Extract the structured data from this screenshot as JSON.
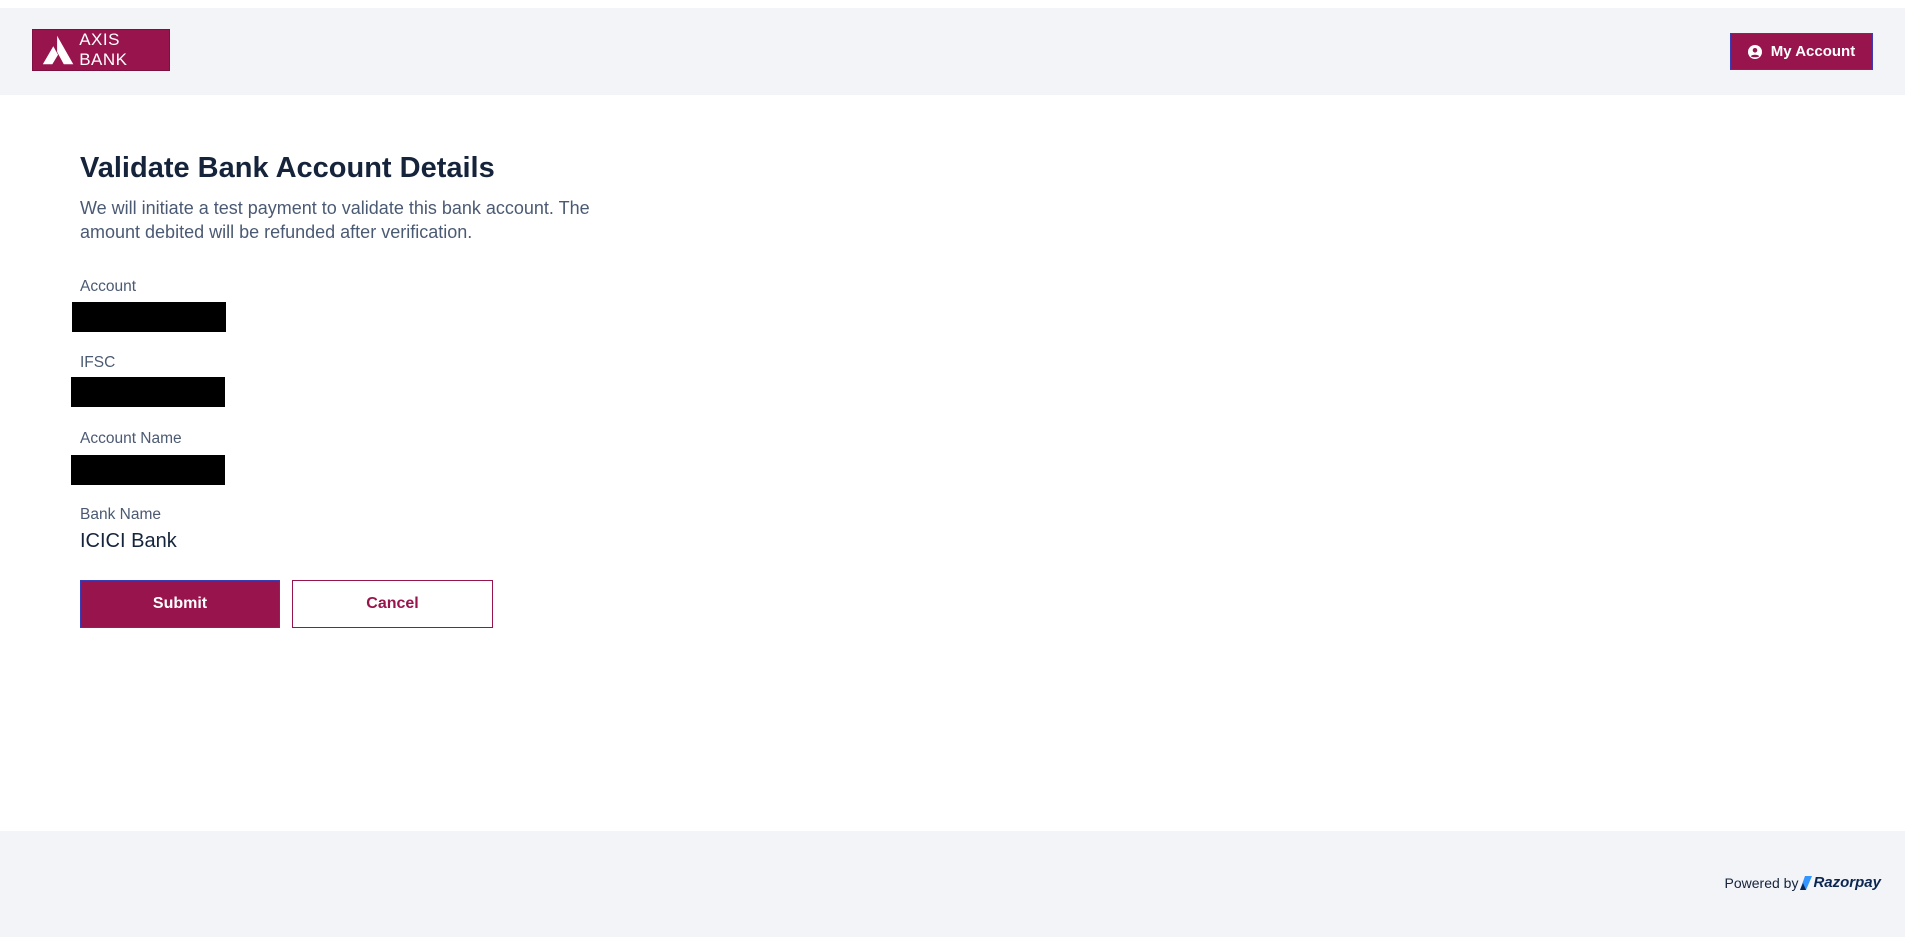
{
  "header": {
    "logo_text": "AXIS BANK",
    "account_button": "My Account",
    "account_icon": "user-circle-icon"
  },
  "page": {
    "title": "Validate Bank Account Details",
    "description": "We will initiate a test payment to validate this bank account. The amount debited will be refunded after verification."
  },
  "fields": {
    "account_label": "Account",
    "ifsc_label": "IFSC",
    "account_name_label": "Account Name",
    "bank_name_label": "Bank Name",
    "bank_name_value": "ICICI Bank"
  },
  "actions": {
    "submit": "Submit",
    "cancel": "Cancel"
  },
  "footer": {
    "powered_by": "Powered by",
    "brand": "Razorpay"
  },
  "colors": {
    "brand": "#97144d",
    "header_bg": "#f2f4f8",
    "focus_border": "#3a3bb5",
    "title_text": "#15233b",
    "muted_text": "#4b5a73"
  }
}
